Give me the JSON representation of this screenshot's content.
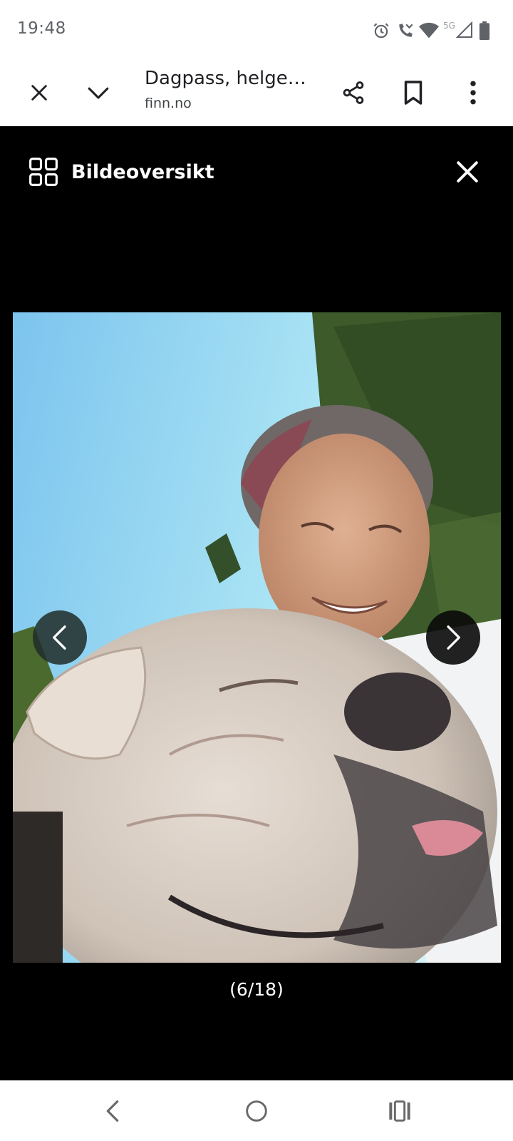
{
  "status_bar": {
    "time": "19:48",
    "network_label": "5G",
    "icons": [
      "alarm-icon",
      "wifi-calling-icon",
      "wifi-icon",
      "cellular-signal-icon",
      "battery-icon"
    ]
  },
  "browser": {
    "title": "Dagpass, helgep...",
    "url": "finn.no",
    "icons": [
      "close-icon",
      "chevron-down-icon",
      "share-icon",
      "bookmark-icon",
      "more-vert-icon"
    ]
  },
  "gallery": {
    "header_label": "Bildeoversikt",
    "header_icon": "grid-icon",
    "close_icon": "close-icon",
    "counter": "(6/18)",
    "prev_icon": "chevron-left-icon",
    "next_icon": "chevron-right-icon",
    "photo_subject": "photo"
  },
  "system_nav": {
    "icons": [
      "back-icon",
      "home-icon",
      "recents-icon"
    ]
  },
  "colors": {
    "gallery_background": "#000000",
    "bar_background": "#ffffff",
    "text_primary": "#202124",
    "status_text": "#5f6368"
  }
}
